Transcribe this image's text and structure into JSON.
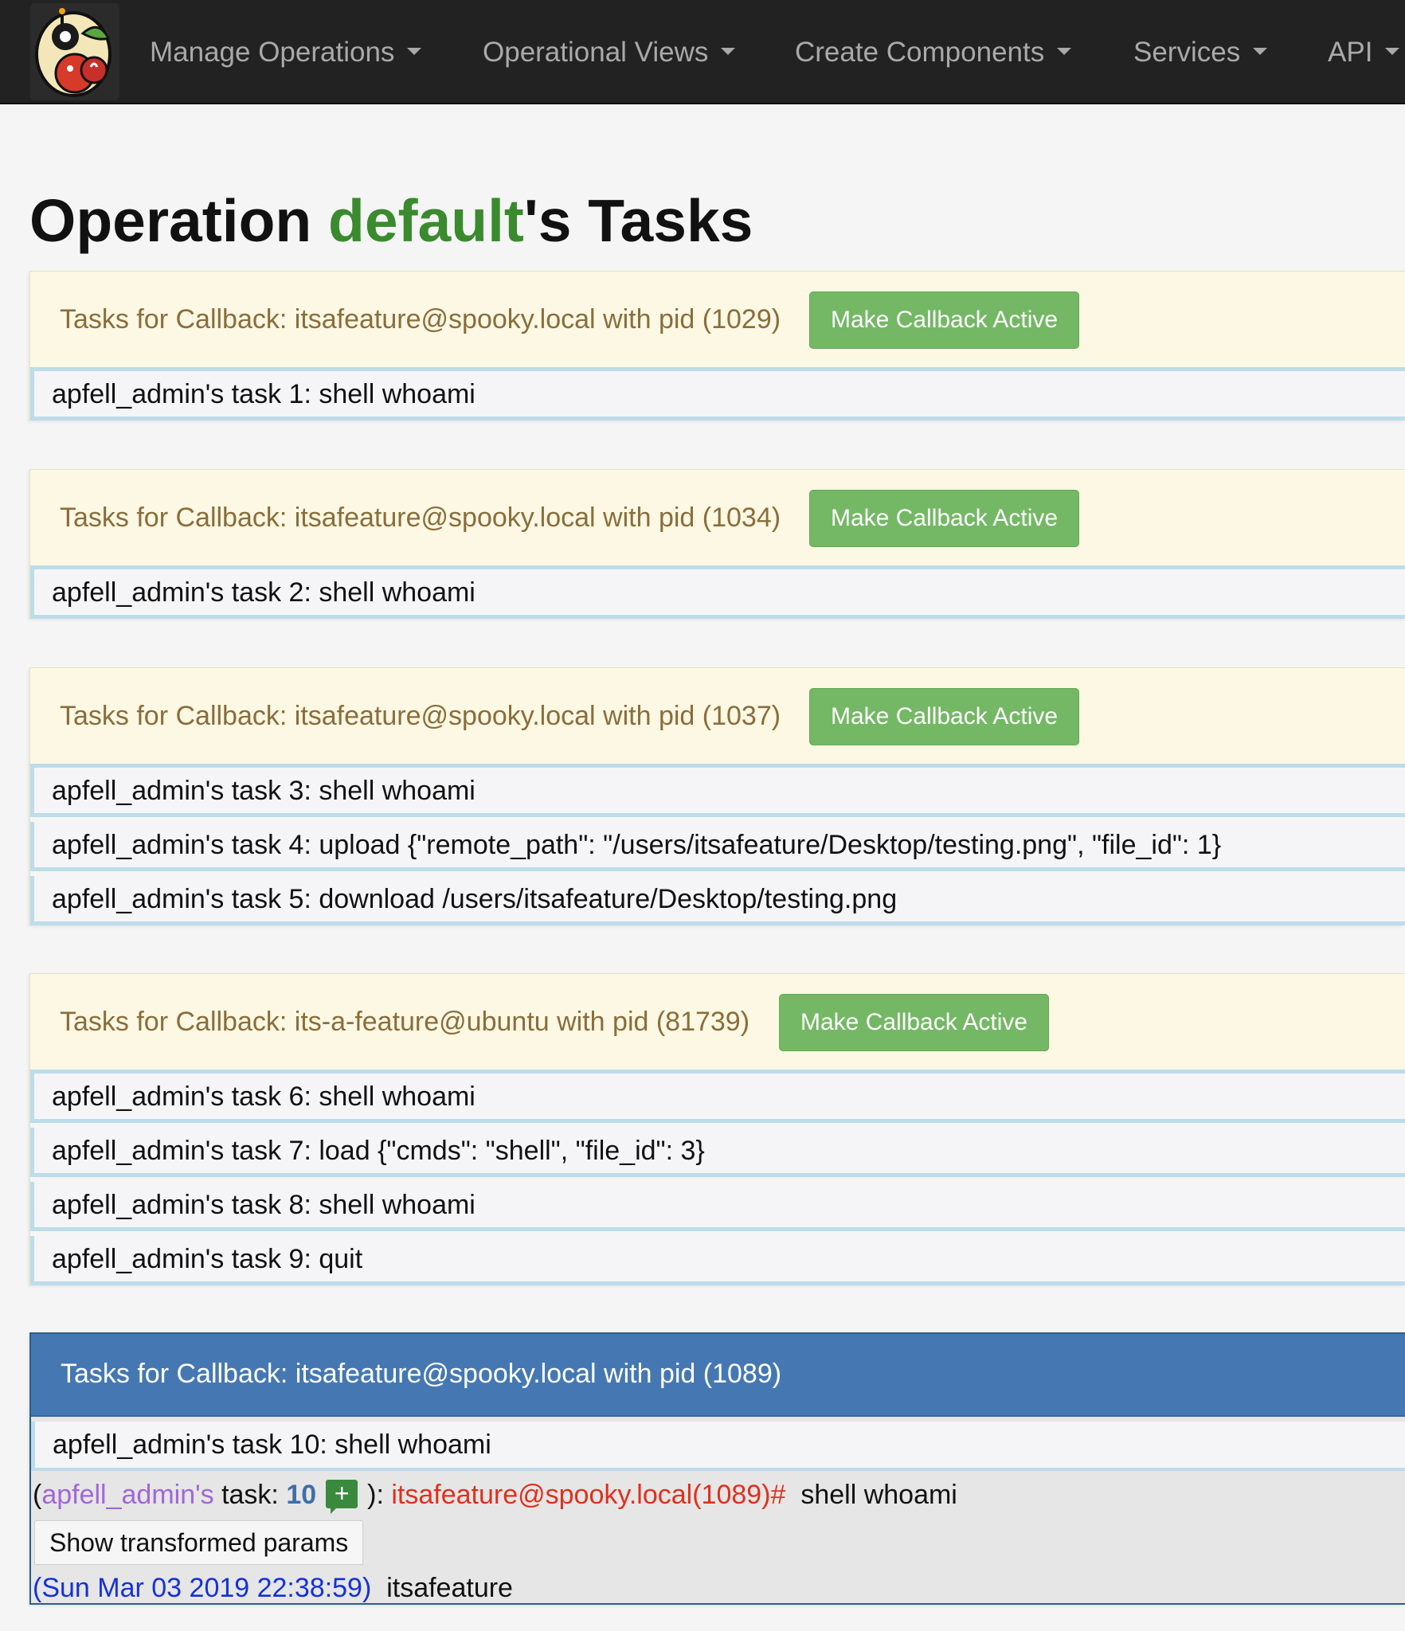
{
  "nav": {
    "items": [
      {
        "label": "Manage Operations"
      },
      {
        "label": "Operational Views"
      },
      {
        "label": "Create Components"
      },
      {
        "label": "Services"
      },
      {
        "label": "API"
      }
    ]
  },
  "page": {
    "title_prefix": "Operation ",
    "operation": "default",
    "title_suffix": "'s Tasks"
  },
  "callbacks": [
    {
      "title": "Tasks for Callback: itsafeature@spooky.local with pid (1029)",
      "button": "Make Callback Active",
      "tasks": [
        "apfell_admin's task 1: shell whoami"
      ]
    },
    {
      "title": "Tasks for Callback: itsafeature@spooky.local with pid (1034)",
      "button": "Make Callback Active",
      "tasks": [
        "apfell_admin's task 2: shell whoami"
      ]
    },
    {
      "title": "Tasks for Callback: itsafeature@spooky.local with pid (1037)",
      "button": "Make Callback Active",
      "tasks": [
        "apfell_admin's task 3: shell whoami",
        "apfell_admin's task 4: upload {\"remote_path\": \"/users/itsafeature/Desktop/testing.png\", \"file_id\": 1}",
        "apfell_admin's task 5: download /users/itsafeature/Desktop/testing.png"
      ]
    },
    {
      "title": "Tasks for Callback: its-a-feature@ubuntu with pid (81739)",
      "button": "Make Callback Active",
      "tasks": [
        "apfell_admin's task 6: shell whoami",
        "apfell_admin's task 7: load {\"cmds\": \"shell\", \"file_id\": 3}",
        "apfell_admin's task 8: shell whoami",
        "apfell_admin's task 9: quit"
      ]
    }
  ],
  "active_callback": {
    "title": "Tasks for Callback: itsafeature@spooky.local with pid (1089)",
    "task": "apfell_admin's task 10: shell whoami",
    "detail": {
      "open_paren": "(",
      "operator": "apfell_admin's",
      "task_label": " task: ",
      "task_number": "10",
      "close": "): ",
      "callback": "itsafeature@spooky.local(1089)#",
      "command": "shell whoami"
    },
    "show_params_label": "Show transformed params",
    "timestamp": "(Sun Mar 03 2019 22:38:59)",
    "response": "itsafeature"
  },
  "colors": {
    "navbar": "#222222",
    "operation_name": "#3a8a2e",
    "warning_heading": "#fcf8e3",
    "warning_text": "#8a6d3b",
    "success_button": "#74b865",
    "active_heading": "#4578b2",
    "operator": "#a067d8",
    "callback_host": "#e0301e",
    "timestamp": "#1531d8"
  },
  "icons": {
    "logo": "apfell-logo",
    "caret": "caret-down-icon",
    "add": "plus-comment-icon"
  }
}
